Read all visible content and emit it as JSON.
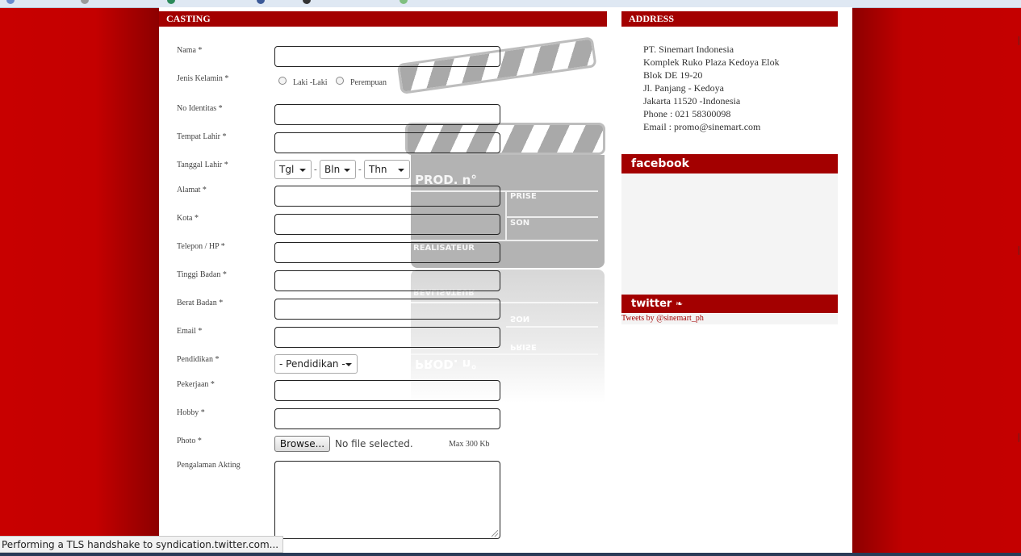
{
  "sections": {
    "casting_title": "CASTING",
    "address_title": "ADDRESS",
    "facebook_title": "facebook",
    "twitter_title": "twitter"
  },
  "form": {
    "labels": {
      "nama": "Nama *",
      "jenis_kelamin": "Jenis Kelamin *",
      "no_identitas": "No Identitas *",
      "tempat_lahir": "Tempat Lahir *",
      "tanggal_lahir": "Tanggal Lahir *",
      "alamat": "Alamat *",
      "kota": "Kota *",
      "telepon": "Telepon / HP *",
      "tinggi_badan": "Tinggi Badan *",
      "berat_badan": "Berat Badan *",
      "email": "Email *",
      "pendidikan": "Pendidikan *",
      "pekerjaan": "Pekerjaan *",
      "hobby": "Hobby *",
      "photo": "Photo *",
      "pengalaman": "Pengalaman Akting"
    },
    "gender_options": [
      "Laki -Laki",
      "Perempuan"
    ],
    "date_selects": {
      "day": "Tgl",
      "month": "Bln",
      "year": "Thn",
      "separator": "-"
    },
    "pendidikan_select": "- Pendidikan -",
    "browse_label": "Browse...",
    "no_file_text": "No file selected.",
    "max_size": "Max 300 Kb"
  },
  "clapperboard": {
    "prod": "PROD. n°",
    "prise": "PRISE",
    "son": "SON",
    "realisateur": "REALISATEUR"
  },
  "address": {
    "lines": [
      "PT. Sinemart Indonesia",
      "Komplek Ruko Plaza Kedoya Elok",
      "Blok DE 19-20",
      "Jl. Panjang - Kedoya",
      "Jakarta 11520 -Indonesia",
      "Phone : 021 58300098",
      "Email : promo@sinemart.com"
    ]
  },
  "twitter": {
    "tweets_link": "Tweets by @sinemart_ph"
  },
  "browser": {
    "status_text": "Performing a TLS handshake to syndication.twitter.com..."
  },
  "colors": {
    "header_red": "#a30000",
    "page_bg_red": "#c00000"
  }
}
